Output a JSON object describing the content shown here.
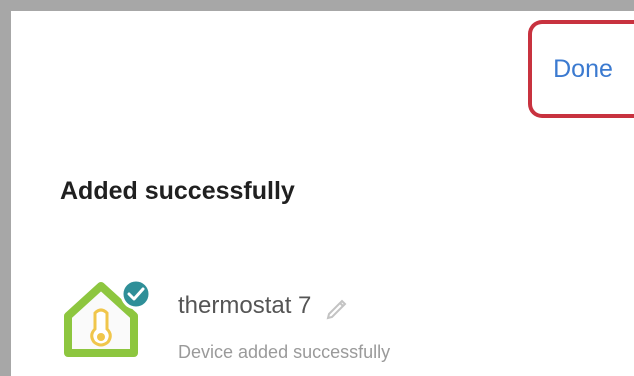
{
  "header": {
    "done_label": "Done"
  },
  "main": {
    "title": "Added successfully",
    "device": {
      "name": "thermostat 7",
      "status": "Device added successfully",
      "icon": "thermostat-home-icon",
      "badge_icon": "check-badge-icon",
      "edit_icon": "pencil-icon"
    }
  },
  "colors": {
    "accent_blue": "#3b7ad0",
    "highlight_red": "#c8323f",
    "icon_green": "#8dc63f",
    "frame_gray": "#a7a7a7"
  }
}
